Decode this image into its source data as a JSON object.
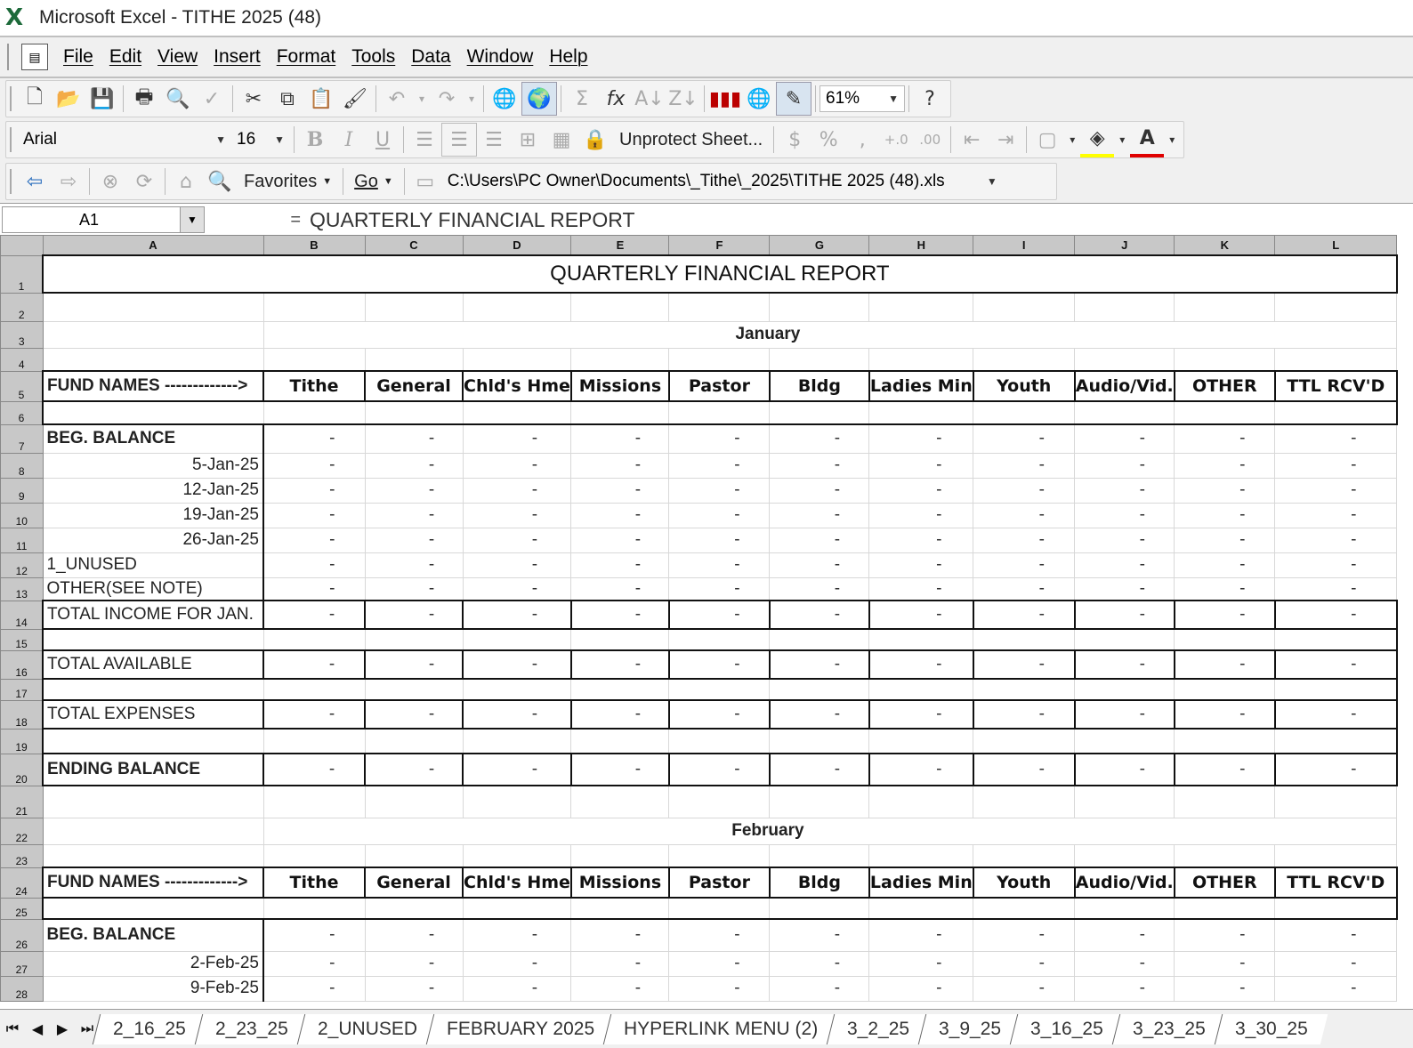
{
  "window": {
    "title": "Microsoft Excel - TITHE 2025 (48)"
  },
  "menu": [
    "File",
    "Edit",
    "View",
    "Insert",
    "Format",
    "Tools",
    "Data",
    "Window",
    "Help"
  ],
  "toolbar": {
    "zoom": "61%"
  },
  "format_toolbar": {
    "font": "Arial",
    "size": "16",
    "unprotect": "Unprotect Sheet..."
  },
  "web_toolbar": {
    "favorites": "Favorites",
    "go": "Go",
    "path": "C:\\Users\\PC Owner\\Documents\\_Tithe\\_2025\\TITHE 2025 (48).xls"
  },
  "formula_bar": {
    "name_box": "A1",
    "equals": "=",
    "content": "QUARTERLY FINANCIAL REPORT"
  },
  "columns": [
    "A",
    "B",
    "C",
    "D",
    "E",
    "F",
    "G",
    "H",
    "I",
    "J",
    "K",
    "L"
  ],
  "sheet": {
    "title": "QUARTERLY FINANCIAL REPORT",
    "fund_label": "FUND NAMES ------------->",
    "funds": [
      "Tithe",
      "General",
      "Chld's Hme",
      "Missions",
      "Pastor",
      "Bldg",
      "Ladies Min",
      "Youth",
      "Audio/Vid.",
      "OTHER",
      "TTL RCV'D"
    ],
    "dash": "-",
    "january": {
      "month": "January",
      "labels": {
        "beg": "BEG. BALANCE",
        "d1": "5-Jan-25",
        "d2": "12-Jan-25",
        "d3": "19-Jan-25",
        "d4": "26-Jan-25",
        "unused": "1_UNUSED",
        "other": "OTHER(SEE NOTE)",
        "total_income": "TOTAL INCOME FOR JAN.",
        "total_available": "TOTAL AVAILABLE",
        "total_expenses": "TOTAL EXPENSES",
        "ending": "ENDING BALANCE"
      }
    },
    "february": {
      "month": "February",
      "labels": {
        "beg": "BEG. BALANCE",
        "d1": "2-Feb-25",
        "d2": "9-Feb-25"
      }
    }
  },
  "tabs": [
    "2_16_25",
    "2_23_25",
    "2_UNUSED",
    "FEBRUARY 2025",
    "HYPERLINK MENU (2)",
    "3_2_25",
    "3_9_25",
    "3_16_25",
    "3_23_25",
    "3_30_25"
  ]
}
